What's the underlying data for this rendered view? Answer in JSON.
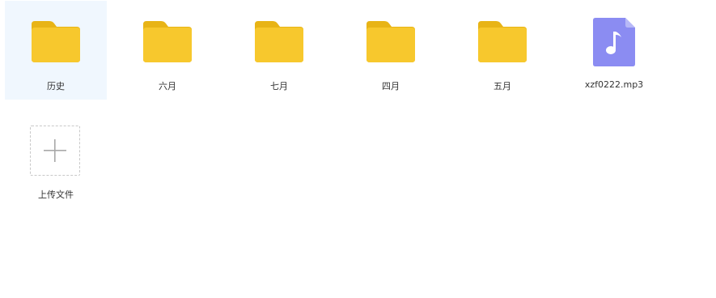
{
  "colors": {
    "folder_front": "#f7c82d",
    "folder_back": "#e8b416",
    "audio_file": "#8b8cf2",
    "audio_fold": "#b7b8f7",
    "selected_bg": "#f0f7fe"
  },
  "items": [
    {
      "type": "folder",
      "label": "历史",
      "icon": "folder-icon",
      "selected": true
    },
    {
      "type": "folder",
      "label": "六月",
      "icon": "folder-icon",
      "selected": false
    },
    {
      "type": "folder",
      "label": "七月",
      "icon": "folder-icon",
      "selected": false
    },
    {
      "type": "folder",
      "label": "四月",
      "icon": "folder-icon",
      "selected": false
    },
    {
      "type": "folder",
      "label": "五月",
      "icon": "folder-icon",
      "selected": false
    },
    {
      "type": "audio",
      "label": "xzf0222.mp3",
      "icon": "music-file-icon",
      "selected": false
    }
  ],
  "upload": {
    "label": "上传文件",
    "icon": "plus-icon"
  }
}
